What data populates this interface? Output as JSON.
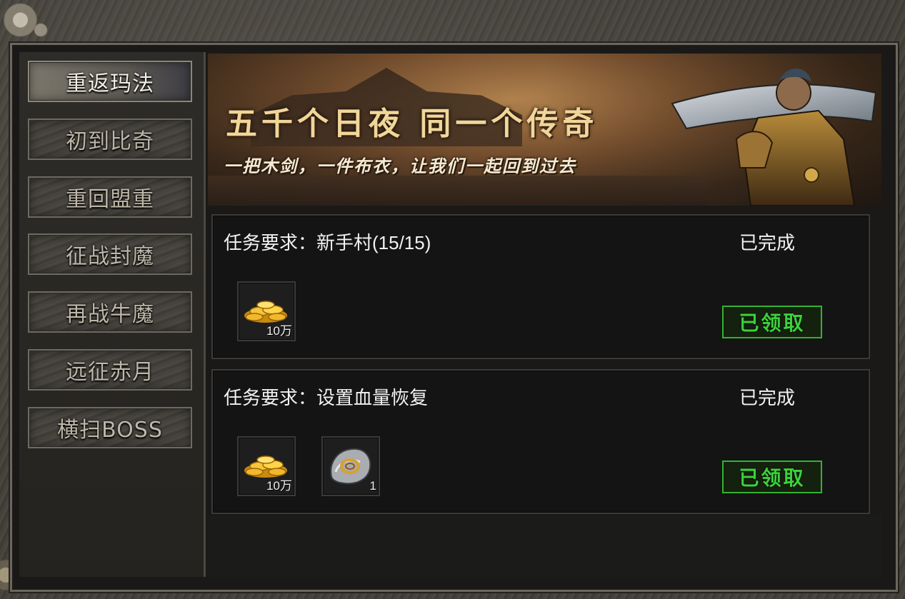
{
  "sidebar": {
    "tabs": [
      {
        "label": "重返玛法",
        "active": true
      },
      {
        "label": "初到比奇",
        "active": false
      },
      {
        "label": "重回盟重",
        "active": false
      },
      {
        "label": "征战封魔",
        "active": false
      },
      {
        "label": "再战牛魔",
        "active": false
      },
      {
        "label": "远征赤月",
        "active": false
      },
      {
        "label": "横扫BOSS",
        "active": false
      }
    ]
  },
  "banner": {
    "title": "五千个日夜  同一个传奇",
    "subtitle": "一把木剑，一件布衣，让我们一起回到过去"
  },
  "quests": [
    {
      "requirement": "任务要求：新手村(15/15)",
      "status": "已完成",
      "rewards": [
        {
          "icon": "gold-coins-icon",
          "count": "10万"
        }
      ],
      "claim_label": "已领取"
    },
    {
      "requirement": "任务要求：设置血量恢复",
      "status": "已完成",
      "rewards": [
        {
          "icon": "gold-coins-icon",
          "count": "10万"
        },
        {
          "icon": "scroll-ring-icon",
          "count": "1"
        }
      ],
      "claim_label": "已领取"
    }
  ],
  "colors": {
    "claim_green": "#3bd13b",
    "panel_bg": "#141414",
    "gold": "#f1d69a"
  }
}
